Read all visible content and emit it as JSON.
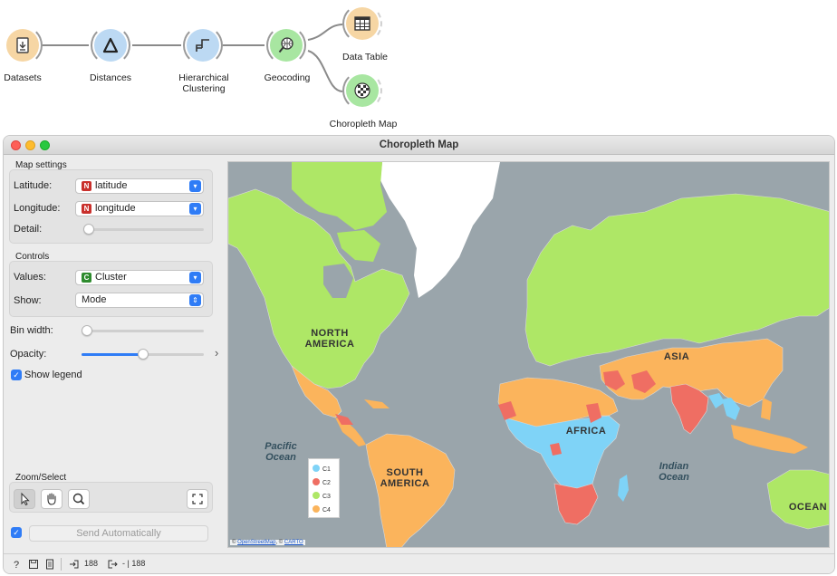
{
  "workflow": {
    "nodes": [
      {
        "label": "Datasets",
        "icon": "datasets-icon",
        "color": "#f6d6a4"
      },
      {
        "label": "Distances",
        "icon": "distances-icon",
        "color": "#bcd9f3"
      },
      {
        "label": "Hierarchical\nClustering",
        "icon": "hierarchical-clustering-icon",
        "color": "#bcd9f3"
      },
      {
        "label": "Geocoding",
        "icon": "geocoding-icon",
        "color": "#a8e6a1"
      },
      {
        "label": "Data Table",
        "icon": "data-table-icon",
        "color": "#f6d6a4"
      },
      {
        "label": "Choropleth Map",
        "icon": "choropleth-map-icon",
        "color": "#a8e6a1"
      }
    ]
  },
  "window": {
    "title": "Choropleth Map"
  },
  "sidebar": {
    "map_settings": "Map settings",
    "latitude_label": "Latitude:",
    "latitude_value": "latitude",
    "latitude_badge": "N",
    "longitude_label": "Longitude:",
    "longitude_value": "longitude",
    "longitude_badge": "N",
    "detail_label": "Detail:",
    "detail_value": 0,
    "controls": "Controls",
    "values_label": "Values:",
    "values_value": "Cluster",
    "values_badge": "C",
    "show_label": "Show:",
    "show_value": "Mode",
    "bin_width_label": "Bin width:",
    "bin_width_value": 0,
    "opacity_label": "Opacity:",
    "opacity_value": 0.5,
    "show_legend_label": "Show legend",
    "show_legend_checked": true,
    "zoom_select": "Zoom/Select",
    "send_automatically": "Send Automatically",
    "send_auto_checked": true
  },
  "map": {
    "labels": {
      "north_america": "NORTH\nAMERICA",
      "south_america": "SOUTH\nAMERICA",
      "africa": "AFRICA",
      "asia": "ASIA",
      "oceania": "OCEAN",
      "pacific": "Pacific\nOcean",
      "indian": "Indian\nOcean"
    },
    "legend": [
      {
        "label": "C1",
        "color": "#7fd3f7"
      },
      {
        "label": "C2",
        "color": "#ef6e63"
      },
      {
        "label": "C3",
        "color": "#aee766"
      },
      {
        "label": "C4",
        "color": "#fbb45c"
      }
    ],
    "attribution_prefix": "©",
    "attribution_osm": "OpenStreetMap",
    "attribution_sep": ", ©",
    "attribution_carto": "CARTO"
  },
  "status": {
    "input_count": "188",
    "output_count": "- | 188"
  },
  "colors": {
    "accent": "#2f7cf6",
    "c1": "#7fd3f7",
    "c2": "#ef6e63",
    "c3": "#aee766",
    "c4": "#fbb45c",
    "water": "#9aa5ab",
    "ice": "#ffffff"
  }
}
